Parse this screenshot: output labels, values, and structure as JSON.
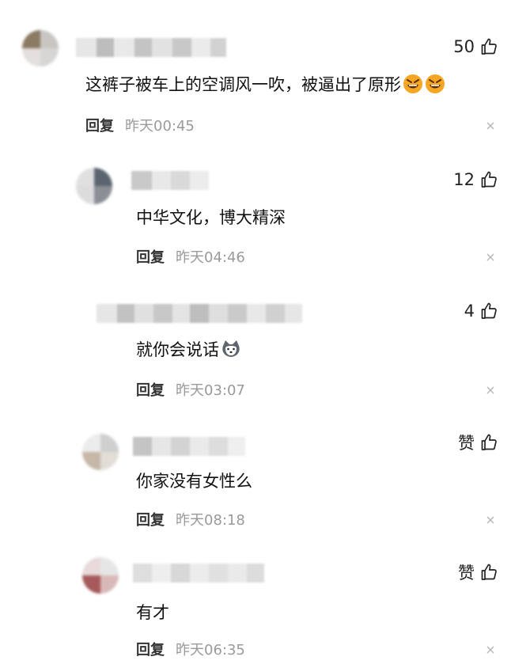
{
  "comments": [
    {
      "likes": "50",
      "text": "这裤子被车上的空调风一吹，被逼出了原形",
      "emojis": [
        "grin-devil-emoji",
        "grin-devil-emoji"
      ],
      "reply": "回复",
      "time": "昨天00:45"
    },
    {
      "likes": "12",
      "text": "中华文化，博大精深",
      "reply": "回复",
      "time": "昨天04:46"
    },
    {
      "likes": "4",
      "text": "就你会说话",
      "emojis": [
        "husky-emoji"
      ],
      "reply": "回复",
      "time": "昨天03:07"
    },
    {
      "likes": "赞",
      "text": "你家没有女性么",
      "reply": "回复",
      "time": "昨天08:18"
    },
    {
      "likes": "赞",
      "text": "有才",
      "reply": "回复",
      "time": "昨天06:35"
    }
  ],
  "icons": {
    "like": "thumbs-up-icon",
    "close": "close-icon"
  },
  "colors": {
    "time": "#9a9a9a",
    "reply": "#333333",
    "emoji_face": "#f5a623"
  }
}
